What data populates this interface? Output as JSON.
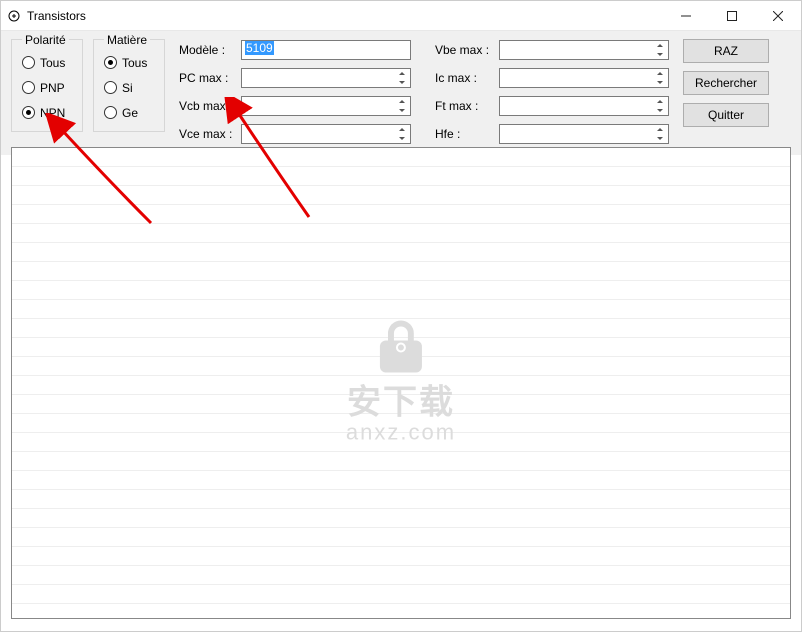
{
  "window": {
    "title": "Transistors"
  },
  "polarite": {
    "legend": "Polarité",
    "options": [
      "Tous",
      "PNP",
      "NPN"
    ],
    "selected": 2
  },
  "matiere": {
    "legend": "Matière",
    "options": [
      "Tous",
      "Si",
      "Ge"
    ],
    "selected": 0
  },
  "fields_left": {
    "modele_label": "Modèle :",
    "modele_value": "5109",
    "pcmax_label": "PC max :",
    "vcbmax_label": "Vcb max :",
    "vcemax_label": "Vce max :"
  },
  "fields_right": {
    "vbemax_label": "Vbe max :",
    "icmax_label": "Ic max :",
    "ftmax_label": "Ft max :",
    "hfe_label": "Hfe :"
  },
  "buttons": {
    "raz": "RAZ",
    "rechercher": "Rechercher",
    "quitter": "Quitter"
  },
  "watermark": {
    "line1": "安下载",
    "line2": "anxz.com"
  }
}
